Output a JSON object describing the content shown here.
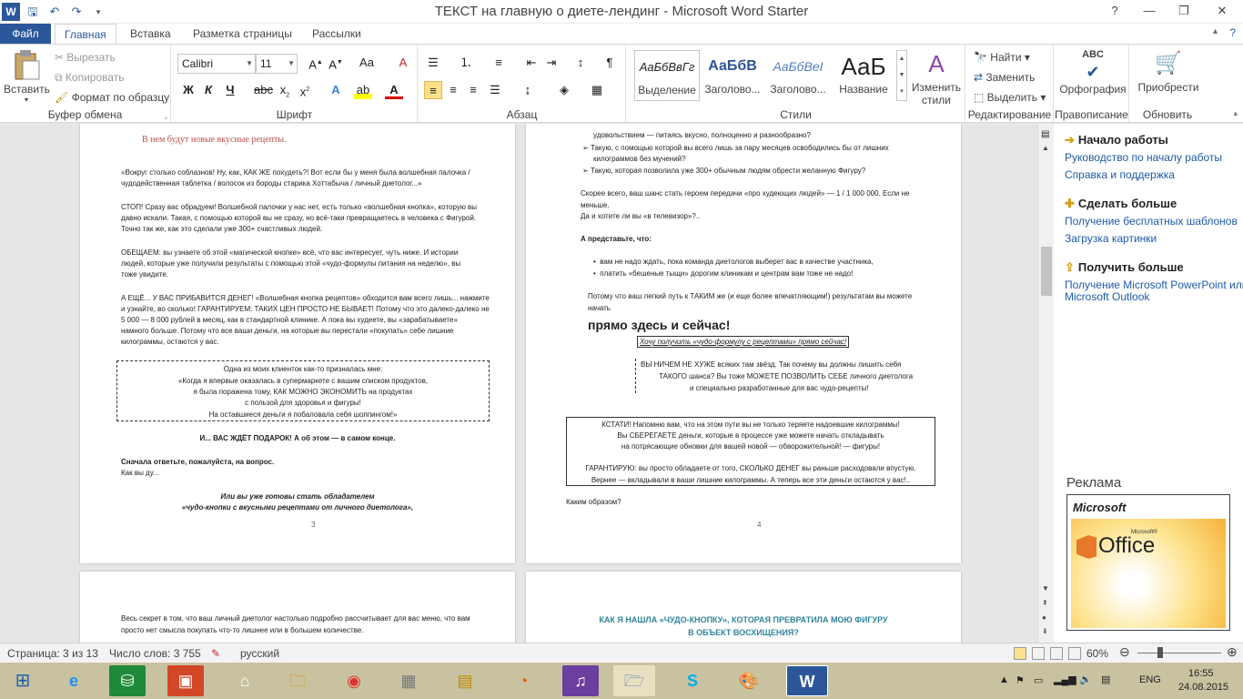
{
  "window": {
    "title": "ТЕКСТ на главную о диете-лендинг  -  Microsoft Word Starter",
    "help_icon": "?",
    "minimize": "—",
    "restore": "❐",
    "close": "✕"
  },
  "tabs": [
    {
      "label": "Файл"
    },
    {
      "label": "Главная"
    },
    {
      "label": "Вставка"
    },
    {
      "label": "Разметка страницы"
    },
    {
      "label": "Рассылки"
    }
  ],
  "ribbon": {
    "clipboard": {
      "paste": "Вставить",
      "cut": "Вырезать",
      "copy": "Копировать",
      "format_painter": "Формат по образцу",
      "label": "Буфер обмена"
    },
    "font": {
      "font_name": "Calibri",
      "font_size": "11",
      "label": "Шрифт"
    },
    "paragraph": {
      "label": "Абзац"
    },
    "styles": {
      "items": [
        {
          "sample": "АаБбВвГг",
          "name": "Выделение"
        },
        {
          "sample": "АаБбВ",
          "name": "Заголово..."
        },
        {
          "sample": "АаБбВеI",
          "name": "Заголово..."
        },
        {
          "sample": "АаБ",
          "name": "Название"
        }
      ],
      "change_styles": "Изменить стили",
      "label": "Стили"
    },
    "editing": {
      "find": "Найти",
      "replace": "Заменить",
      "select": "Выделить",
      "label": "Редактирование"
    },
    "proofing": {
      "spelling": "Орфография",
      "abc": "ABC",
      "label": "Правописание"
    },
    "update": {
      "get_more": "Приобрести",
      "label": "Обновить"
    }
  },
  "page3": {
    "heading": "В нем будут новые вкусные рецепты.",
    "lines": [
      "«Вокруг столько соблазнов! Ну, как, КАК ЖЕ похудеть?! Вот если бы у меня была волшебная палочка /",
      "чудодейственная таблетка / волосок из бороды старика Хоттабыча / личный диетолог...»",
      "СТОП! Сразу вас обрадуем! Волшебной палочки у нас нет, есть только «волшебная кнопка», которую вы",
      "давно искали. Такая, с помощью которой вы не сразу, но всё-таки превращаетесь в человека с Фигурой.",
      "Точно так же, как это сделали уже 300+ счастливых людей.",
      "ОБЕЩАЕМ: вы узнаете об этой «магической кнопке» всё, что вас интересует, чуть ниже. И истории",
      "людей, которые уже получили результаты с помощью этой «чудо-формулы питания на неделю», вы",
      "тоже увидите.",
      "А ЕЩЁ... У ВАС ПРИБАВИТСЯ ДЕНЕГ! «Волшебная кнопка рецептов» обходится вам всего лишь... нажмите",
      "и узнайте, во сколько! ГАРАНТИРУЕМ: ТАКИХ ЦЕН ПРОСТО НЕ БЫВАЕТ! Потому что это далеко-далеко не",
      "5 000 — 8 000 рублей в месяц, как в стандартной клинике. А пока вы худеете, вы «зарабатываете»",
      "намного больше. Потому что все ваши деньги, на которые вы перестали «покупать» себе лишние",
      "килограммы, остаются у вас."
    ],
    "box_lines": [
      "Одна из моих клиенток как-то призналась мне:",
      "«Когда я впервые оказалась в супермаркете с вашим списком продуктов,",
      "я была поражена тому, КАК МОЖНО ЭКОНОМИТЬ на продуктах",
      "с пользой для здоровья и фигуры!",
      "На оставшиеся деньги я побаловала себя шоппингом!»"
    ],
    "gift": "И... ВАС ЖДЁТ ПОДАРОК! А об этом — в самом конце.",
    "q1": "Сначала ответьте, пожалуйста, на вопрос.",
    "q2": "Как вы ду...",
    "italic1": "Или вы уже готовы стать обладателем",
    "italic2": "«чудо-кнопки с вкусными рецептами от личного диетолога»,",
    "num": "3"
  },
  "page4": {
    "lines_top": [
      "удовольствием — питаясь вкусно, полноценно и разнообразно?",
      "Такую, с помощью которой вы всего лишь за пару месяцев освободились бы от лишних",
      "килограммов без мучений?",
      "Такую, которая позволила уже 300+ обычным людям обрести желанную Фигуру?"
    ],
    "lines_mid": [
      "Скорее всего, ваш шанс стать героем передачи «про худеющих людей» — 1 / 1 000 000. Если не",
      "меньше.",
      "Да и хотите ли вы «в телевизор»?.."
    ],
    "imagine": "А представьте, что:",
    "bullets": [
      "вам не надо ждать, пока команда диетологов выберет вас в качестве участника,",
      "платить «бешеные тыщи» дорогим клиникам и центрам вам тоже не надо!"
    ],
    "because1": "Потому что ваш легкий путь к ТАКИМ же (и еще более впечатляющим!) результатам вы можете",
    "because2": "начать",
    "big": "прямо здесь и сейчас!",
    "button_text": "Хочу получить «чудо-формулу с рецептами» прямо сейчас!",
    "block_lines": [
      "ВЫ НИЧЕМ НЕ ХУЖЕ всяких там звёзд. Так почему вы должны лишить себя",
      "ТАКОГО шанса? Вы тоже МОЖЕТЕ ПОЗВОЛИТЬ СЕБЕ личного диетолога",
      "и специально разработанные для вас чудо-рецепты!"
    ],
    "box_lines": [
      "КСТАТИ! Напомню вам, что на этом пути вы не только теряете надоевшие килограммы!",
      "Вы СБЕРЕГАЕТЕ деньги, которые в процессе уже можете начать откладывать",
      "на потрясающие обновки для вашей новой — обворожительной! — фигуры!",
      "",
      "ГАРАНТИРУЮ: вы просто обладаете от того, СКОЛЬКО ДЕНЕГ вы раньше расходовали впустую.",
      "Вернее — вкладывали в ваши лишние килограммы. А теперь все эти деньги остаются у вас!.."
    ],
    "how": "Каким образом?",
    "num": "4"
  },
  "page5": {
    "line1": "Весь секрет в том, что ваш личный диетолог настолько подробно рассчитывает для вас меню, что вам",
    "line2": "просто нет смысла покупать что-то лишнее или в большем количестве."
  },
  "page6": {
    "h1": "КАК Я НАШЛА «ЧУДО-КНОПКУ», КОТОРАЯ ПРЕВРАТИЛА МОЮ ФИГУРУ",
    "h2": "В ОБЪЕКТ ВОСХИЩЕНИЯ?"
  },
  "sidepane": {
    "start_title": "Начало работы",
    "start_link1": "Руководство по началу работы",
    "start_link2": "Справка и поддержка",
    "more_title": "Сделать больше",
    "more_link1": "Получение бесплатных шаблонов",
    "more_link2": "Загрузка картинки",
    "get_title": "Получить больше",
    "get_link1": "Получение Microsoft PowerPoint или",
    "get_link2": "Microsoft Outlook",
    "ad_label": "Реклама",
    "ad_brand": "Microsoft",
    "ad_product": "Office",
    "ad_small": "Microsoft®"
  },
  "status": {
    "page": "Страница: 3 из 13",
    "words": "Число слов: 3 755",
    "language": "русский",
    "zoom": "60%"
  },
  "tray": {
    "lang": "ENG",
    "time": "16:55",
    "date": "24.08.2015"
  },
  "colors": {
    "accent": "#2b579a",
    "heading_orange": "#c0504d",
    "teal": "#31849b"
  }
}
